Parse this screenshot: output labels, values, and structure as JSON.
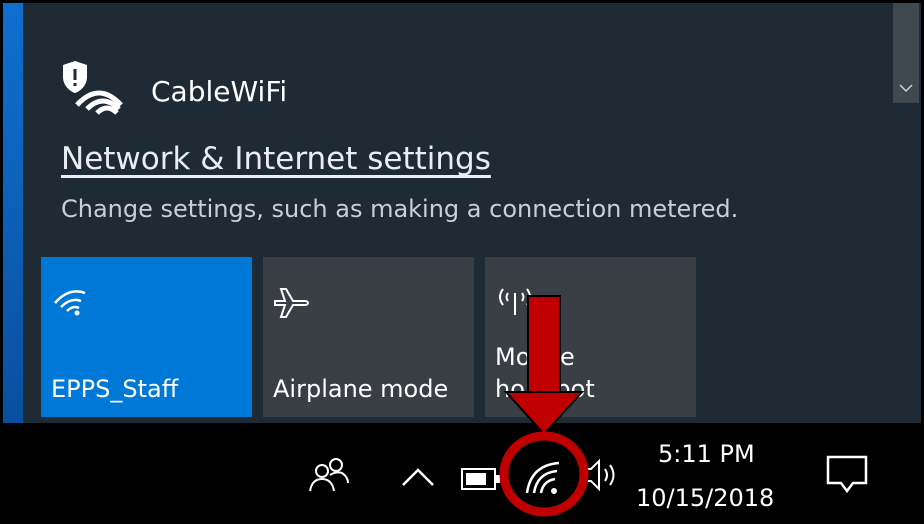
{
  "flyout": {
    "network": {
      "name": "CableWiFi",
      "icon": "secured-wifi-icon"
    },
    "settings_link": "Network & Internet settings",
    "settings_description": "Change settings, such as making a connection metered.",
    "tiles": [
      {
        "label": "EPPS_Staff",
        "icon": "wifi-icon",
        "active": true
      },
      {
        "label": "Airplane mode",
        "icon": "airplane-icon",
        "active": false
      },
      {
        "label_line1": "Mo   le",
        "label_line2": "ho    pot",
        "icon": "mobile-hotspot-icon",
        "active": false
      }
    ]
  },
  "taskbar": {
    "time": "5:11 PM",
    "date": "10/15/2018",
    "icons": [
      "people-icon",
      "chevron-up-icon",
      "battery-icon",
      "wifi-icon",
      "volume-icon",
      "action-center-icon"
    ]
  },
  "annotation": {
    "arrow_color": "#c00000",
    "circle_color": "#c00000"
  },
  "colors": {
    "accent": "#0078d7",
    "tile": "#3a3f45",
    "flyout": "#1e2a34"
  }
}
